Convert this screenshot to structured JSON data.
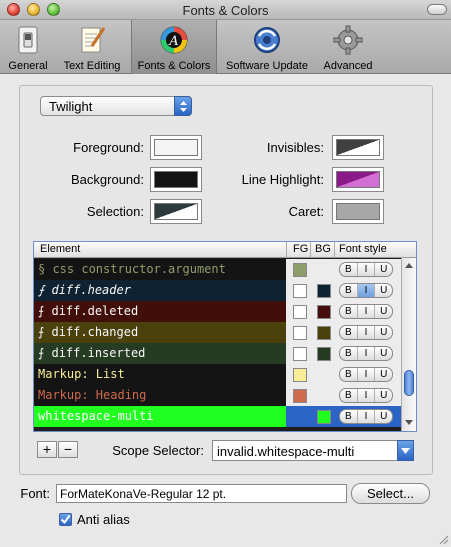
{
  "window": {
    "title": "Fonts & Colors"
  },
  "toolbar": {
    "items": [
      {
        "label": "General",
        "icon": "light-switch-icon"
      },
      {
        "label": "Text Editing",
        "icon": "notepad-pen-icon"
      },
      {
        "label": "Fonts & Colors",
        "icon": "color-wheel-icon",
        "selected": true
      },
      {
        "label": "Software Update",
        "icon": "sync-globe-icon"
      },
      {
        "label": "Advanced",
        "icon": "gear-icon"
      }
    ]
  },
  "theme": {
    "selected": "Twilight"
  },
  "colors": {
    "foreground": {
      "label": "Foreground:",
      "value": "#f5f5f5"
    },
    "background": {
      "label": "Background:",
      "value": "#141414"
    },
    "selection": {
      "label": "Selection:",
      "value": "#2e3b3e"
    },
    "invisibles": {
      "label": "Invisibles:",
      "value": "#404040"
    },
    "line_highlight": {
      "label": "Line Highlight:",
      "value": "#8a1a8a"
    },
    "caret": {
      "label": "Caret:",
      "value": "#a7a7a7"
    }
  },
  "table": {
    "headers": {
      "element": "Element",
      "fg": "FG",
      "bg": "BG",
      "style": "Font style"
    },
    "style_buttons": {
      "bold": "B",
      "italic": "I",
      "underline": "U"
    },
    "rows": [
      {
        "name": "§ css constructor.argument",
        "text_color": "#8f9d6a",
        "row_bg": "#141414",
        "fg": "#8f9d6a",
        "bg": null,
        "italic": false
      },
      {
        "name": "⨍ diff.header",
        "text_color": "#f8f8f8",
        "row_bg": "#0e2231",
        "fg": null,
        "bg": "#0e2231",
        "italic": true
      },
      {
        "name": "⨍ diff.deleted",
        "text_color": "#f8f8f8",
        "row_bg": "#420e09",
        "fg": null,
        "bg": "#420e09",
        "italic": false
      },
      {
        "name": "⨍ diff.changed",
        "text_color": "#f8f8f8",
        "row_bg": "#4a410d",
        "fg": null,
        "bg": "#4a410d",
        "italic": false
      },
      {
        "name": "⨍ diff.inserted",
        "text_color": "#f8f8f8",
        "row_bg": "#253b22",
        "fg": null,
        "bg": "#253b22",
        "italic": false
      },
      {
        "name": "Markup: List",
        "text_color": "#f9ee98",
        "row_bg": "#141414",
        "fg": "#f9ee98",
        "bg": null,
        "italic": false
      },
      {
        "name": "Markup: Heading",
        "text_color": "#cf6a4c",
        "row_bg": "#141414",
        "fg": "#cf6a4c",
        "bg": null,
        "italic": false
      },
      {
        "name": "whitespace-multi",
        "text_color": "#ffffff",
        "row_bg": "#21ff21",
        "fg": null,
        "bg": "#21ff21",
        "italic": false,
        "selected": true
      }
    ]
  },
  "scope": {
    "label": "Scope Selector:",
    "value": "invalid.whitespace-multi"
  },
  "font": {
    "label": "Font:",
    "value": "ForMateKonaVe-Regular 12 pt.",
    "select_button": "Select..."
  },
  "anti_alias": {
    "label": "Anti alias",
    "checked": true
  },
  "accent": "#2a64c6"
}
